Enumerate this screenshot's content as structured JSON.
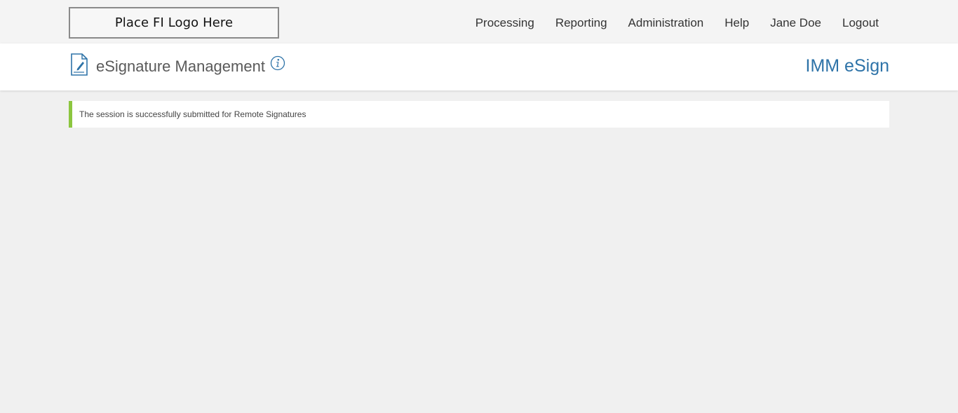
{
  "header": {
    "logo_text": "Place FI Logo Here",
    "nav": [
      {
        "label": "Processing"
      },
      {
        "label": "Reporting"
      },
      {
        "label": "Administration"
      },
      {
        "label": "Help"
      },
      {
        "label": "Jane Doe"
      },
      {
        "label": "Logout"
      }
    ]
  },
  "subheader": {
    "page_icon": "document-signature-icon",
    "title": "eSignature Management",
    "info_icon": "info-icon",
    "brand": "IMM eSign"
  },
  "alert": {
    "message": "The session is successfully submitted for Remote Signatures",
    "status_color": "#8cc63f"
  },
  "colors": {
    "accent": "#2e73a8",
    "success": "#8cc63f",
    "background": "#f0f0f0"
  }
}
